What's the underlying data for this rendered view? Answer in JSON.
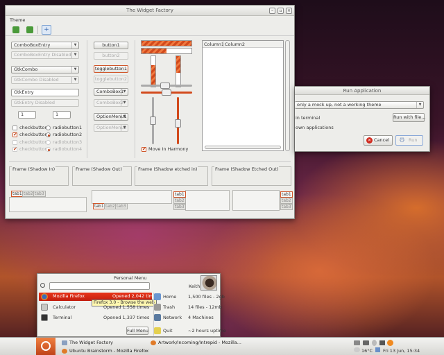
{
  "widget_factory": {
    "title": "The Widget Factory",
    "menu": "Theme",
    "entries": {
      "combo_entry": "ComboBoxEntry",
      "combo_entry_disabled": "ComboBoxEntry Disabled",
      "gtk_combo": "GtkCombo",
      "gtk_combo_disabled": "GtkCombo Disabled",
      "gtk_entry": "GtkEntry",
      "gtk_entry_disabled": "GtkEntry Disabled"
    },
    "spin1": "1",
    "spin2": "1",
    "checks": [
      "checkbutton1",
      "checkbutton2",
      "checkbutton3",
      "checkbutton4"
    ],
    "radios": [
      "radiobutton1",
      "radiobutton2",
      "radiobutton3",
      "radiobutton4"
    ],
    "buttons": {
      "b1": "button1",
      "b2": "button2",
      "t1": "togglebutton1",
      "t2": "togglebutton2",
      "c1": "ComboBox1",
      "c2": "ComboBox2",
      "o1": "OptionMenu1",
      "o2": "OptionMenu2"
    },
    "move_harmony": "Move In Harmony",
    "columns": [
      "Column1",
      "Column2"
    ],
    "frames": [
      "Frame (Shadow In)",
      "Frame (Shadow Out)",
      "Frame (Shadow etched in)",
      "Frame (Shadow Etched Out)"
    ],
    "tabs": [
      "tab1",
      "tab2",
      "tab3"
    ]
  },
  "run_dialog": {
    "title": "Run Application",
    "command": "only a mock up, not a working theme",
    "in_terminal": "in terminal",
    "run_with_file": "Run with file...",
    "known_apps": "own applications",
    "cancel": "Cancel",
    "run": "Run"
  },
  "personal_menu": {
    "title": "Personal Menu",
    "user": "Keith",
    "apps": [
      {
        "name": "Mozilla Firefox",
        "count": "Opened 2,042 times"
      },
      {
        "name": "Calculator",
        "count": "Opened 1,558 times"
      },
      {
        "name": "Terminal",
        "count": "Opened 1,337 times"
      }
    ],
    "tooltip": "Firefox 3.0 - Browse the web",
    "full_menu": "Full Menu",
    "places": [
      {
        "name": "Home",
        "info": "1,500 files - 2gb"
      },
      {
        "name": "Trash",
        "info": "14 files - 12mb"
      },
      {
        "name": "Network",
        "info": "4 Machines"
      },
      {
        "name": "Quit",
        "info": "~2 hours uptime"
      }
    ]
  },
  "panel": {
    "tasks": [
      "The Widget Factory",
      "Artwork/Incoming/Intrepid - Mozilla...",
      "Ubuntu Brainstorm - Mozilla Firefox"
    ],
    "temp": "16°C",
    "clock": "Fri 13 Jun, 15:34"
  }
}
